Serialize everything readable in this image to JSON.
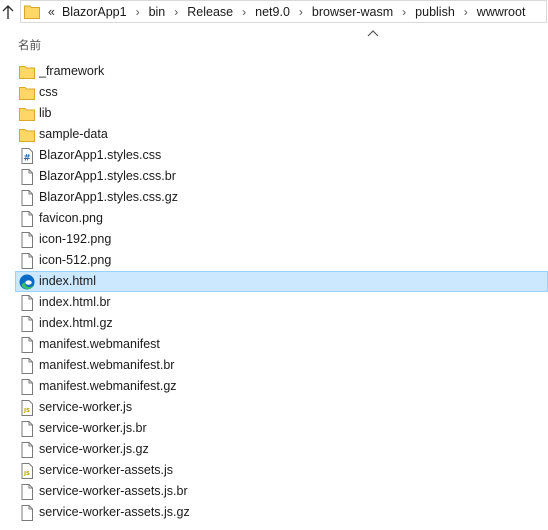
{
  "address_bar": {
    "overflow": "«",
    "crumbs": [
      "BlazorApp1",
      "bin",
      "Release",
      "net9.0",
      "browser-wasm",
      "publish",
      "wwwroot"
    ],
    "separator": "›"
  },
  "column_header": {
    "name": "名前",
    "sort_direction": "ascending"
  },
  "files": [
    {
      "name": "_framework",
      "icon": "folder"
    },
    {
      "name": "css",
      "icon": "folder"
    },
    {
      "name": "lib",
      "icon": "folder"
    },
    {
      "name": "sample-data",
      "icon": "folder"
    },
    {
      "name": "BlazorApp1.styles.css",
      "icon": "css-file"
    },
    {
      "name": "BlazorApp1.styles.css.br",
      "icon": "file"
    },
    {
      "name": "BlazorApp1.styles.css.gz",
      "icon": "file"
    },
    {
      "name": "favicon.png",
      "icon": "file"
    },
    {
      "name": "icon-192.png",
      "icon": "file"
    },
    {
      "name": "icon-512.png",
      "icon": "file"
    },
    {
      "name": "index.html",
      "icon": "edge",
      "selected": true
    },
    {
      "name": "index.html.br",
      "icon": "file"
    },
    {
      "name": "index.html.gz",
      "icon": "file"
    },
    {
      "name": "manifest.webmanifest",
      "icon": "file"
    },
    {
      "name": "manifest.webmanifest.br",
      "icon": "file"
    },
    {
      "name": "manifest.webmanifest.gz",
      "icon": "file"
    },
    {
      "name": "service-worker.js",
      "icon": "js-file"
    },
    {
      "name": "service-worker.js.br",
      "icon": "file"
    },
    {
      "name": "service-worker.js.gz",
      "icon": "file"
    },
    {
      "name": "service-worker-assets.js",
      "icon": "js-file"
    },
    {
      "name": "service-worker-assets.js.br",
      "icon": "file"
    },
    {
      "name": "service-worker-assets.js.gz",
      "icon": "file"
    }
  ],
  "colors": {
    "selection_bg": "#cce8ff",
    "selection_border": "#99d1ff",
    "folder": "#ffd766",
    "edge_blue": "#0c6bc7",
    "edge_green": "#3ebf6f"
  }
}
